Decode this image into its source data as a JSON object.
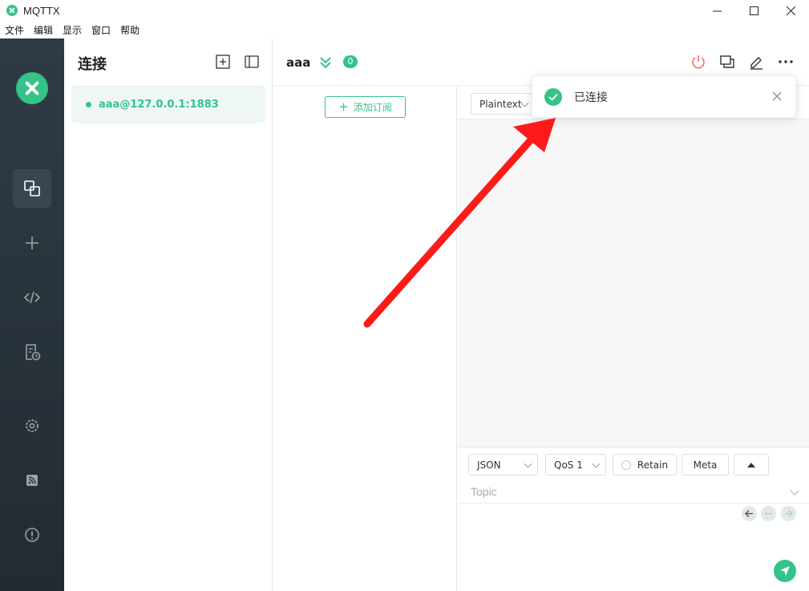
{
  "window": {
    "title": "MQTTX",
    "controls": [
      "minimize-icon",
      "maximize-icon",
      "close-icon"
    ]
  },
  "menu": [
    "文件",
    "编辑",
    "显示",
    "窗口",
    "帮助"
  ],
  "rail": {
    "icons": [
      "connections-icon",
      "add-icon",
      "script-icon",
      "log-icon",
      "settings-icon",
      "feed-icon",
      "about-icon"
    ],
    "active": "connections-icon"
  },
  "connections": {
    "title": "连接",
    "items": [
      {
        "name": "aaa@127.0.0.1:1883",
        "status": "connected"
      }
    ]
  },
  "header": {
    "name": "aaa",
    "badge_count": "0"
  },
  "subscriptions": {
    "add_label": "添加订阅"
  },
  "messages": {
    "format": "Plaintext"
  },
  "publish": {
    "format": "JSON",
    "qos": "QoS 1",
    "retain_label": "Retain",
    "meta_label": "Meta",
    "topic_placeholder": "Topic"
  },
  "toast": {
    "message": "已连接",
    "type": "success"
  },
  "colors": {
    "accent": "#34c388",
    "rail_bg": "#2b353d",
    "arrow": "#ff1a1a"
  }
}
